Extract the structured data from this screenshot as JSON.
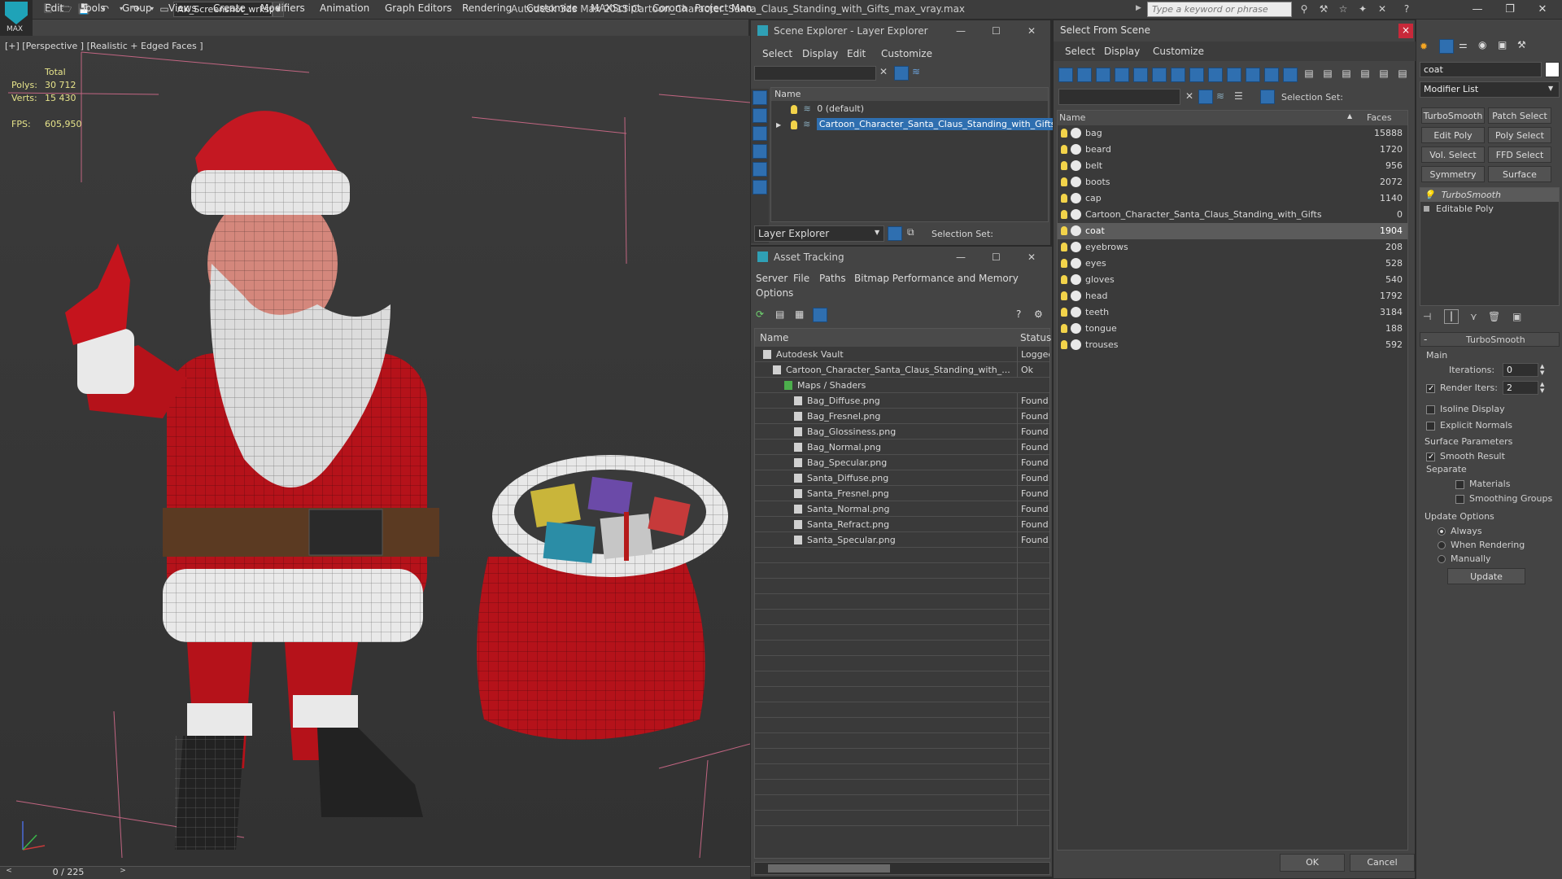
{
  "app": {
    "logo_text": "MAX",
    "workspace": "AK_Screenshot_wrksp",
    "title": "Autodesk 3ds Max  2015    Cartoon_Character_Santa_Claus_Standing_with_Gifts_max_vray.max",
    "search_placeholder": "Type a keyword or phrase"
  },
  "menu": [
    "Edit",
    "Tools",
    "Group",
    "Views",
    "Create",
    "Modifiers",
    "Animation",
    "Graph Editors",
    "Rendering",
    "Customize",
    "MAXScript",
    "Corona",
    "Project Man"
  ],
  "viewport": {
    "label": "[+] [Perspective ] [Realistic + Edged Faces ]",
    "stats": {
      "total_label": "Total",
      "polys_label": "Polys:",
      "polys": "30 712",
      "verts_label": "Verts:",
      "verts": "15 430",
      "fps_label": "FPS:",
      "fps": "605,950"
    },
    "frame": "0 / 225"
  },
  "scene_explorer": {
    "title": "Scene Explorer - Layer Explorer",
    "menu": [
      "Select",
      "Display",
      "Edit",
      "Customize"
    ],
    "col_name": "Name",
    "layers": [
      "0 (default)",
      "Cartoon_Character_Santa_Claus_Standing_with_Gifts"
    ],
    "footer_left": "Layer Explorer",
    "footer_right": "Selection Set:"
  },
  "asset_tracking": {
    "title": "Asset Tracking",
    "menu": [
      "Server",
      "File",
      "Paths",
      "Bitmap Performance and Memory",
      "Options"
    ],
    "col_name": "Name",
    "col_status": "Status",
    "rows": [
      {
        "name": "Autodesk Vault",
        "status": "Logged"
      },
      {
        "name": "Cartoon_Character_Santa_Claus_Standing_with_...",
        "status": "Ok"
      },
      {
        "name": "Maps / Shaders",
        "status": ""
      },
      {
        "name": "Bag_Diffuse.png",
        "status": "Found"
      },
      {
        "name": "Bag_Fresnel.png",
        "status": "Found"
      },
      {
        "name": "Bag_Glossiness.png",
        "status": "Found"
      },
      {
        "name": "Bag_Normal.png",
        "status": "Found"
      },
      {
        "name": "Bag_Specular.png",
        "status": "Found"
      },
      {
        "name": "Santa_Diffuse.png",
        "status": "Found"
      },
      {
        "name": "Santa_Fresnel.png",
        "status": "Found"
      },
      {
        "name": "Santa_Normal.png",
        "status": "Found"
      },
      {
        "name": "Santa_Refract.png",
        "status": "Found"
      },
      {
        "name": "Santa_Specular.png",
        "status": "Found"
      }
    ]
  },
  "select_from_scene": {
    "title": "Select From Scene",
    "close": "×",
    "menu": [
      "Select",
      "Display",
      "Customize"
    ],
    "selection_set": "Selection Set:",
    "col_name": "Name",
    "col_faces": "Faces",
    "objects": [
      {
        "name": "bag",
        "faces": "15888"
      },
      {
        "name": "beard",
        "faces": "1720"
      },
      {
        "name": "belt",
        "faces": "956"
      },
      {
        "name": "boots",
        "faces": "2072"
      },
      {
        "name": "cap",
        "faces": "1140"
      },
      {
        "name": "Cartoon_Character_Santa_Claus_Standing_with_Gifts",
        "faces": "0"
      },
      {
        "name": "coat",
        "faces": "1904"
      },
      {
        "name": "eyebrows",
        "faces": "208"
      },
      {
        "name": "eyes",
        "faces": "528"
      },
      {
        "name": "gloves",
        "faces": "540"
      },
      {
        "name": "head",
        "faces": "1792"
      },
      {
        "name": "teeth",
        "faces": "3184"
      },
      {
        "name": "tongue",
        "faces": "188"
      },
      {
        "name": "trouses",
        "faces": "592"
      }
    ],
    "selected": "coat",
    "ok": "OK",
    "cancel": "Cancel"
  },
  "command_panel": {
    "object_name": "coat",
    "modifier_list": "Modifier List",
    "buttons": [
      "TurboSmooth",
      "Patch Select",
      "Edit Poly",
      "Poly Select",
      "Vol. Select",
      "FFD Select",
      "Symmetry",
      "Surface Select"
    ],
    "stack": [
      "TurboSmooth",
      "Editable Poly"
    ],
    "rollout_title": "TurboSmooth",
    "main_label": "Main",
    "iterations_label": "Iterations:",
    "iterations": "0",
    "render_iters_label": "Render Iters:",
    "render_iters": "2",
    "isoline": "Isoline Display",
    "explicit_normals": "Explicit Normals",
    "surface_params": "Surface Parameters",
    "smooth_result": "Smooth Result",
    "separate": "Separate",
    "materials": "Materials",
    "smoothing_groups": "Smoothing Groups",
    "update_options": "Update Options",
    "always": "Always",
    "when_rendering": "When Rendering",
    "manually": "Manually",
    "update": "Update"
  }
}
